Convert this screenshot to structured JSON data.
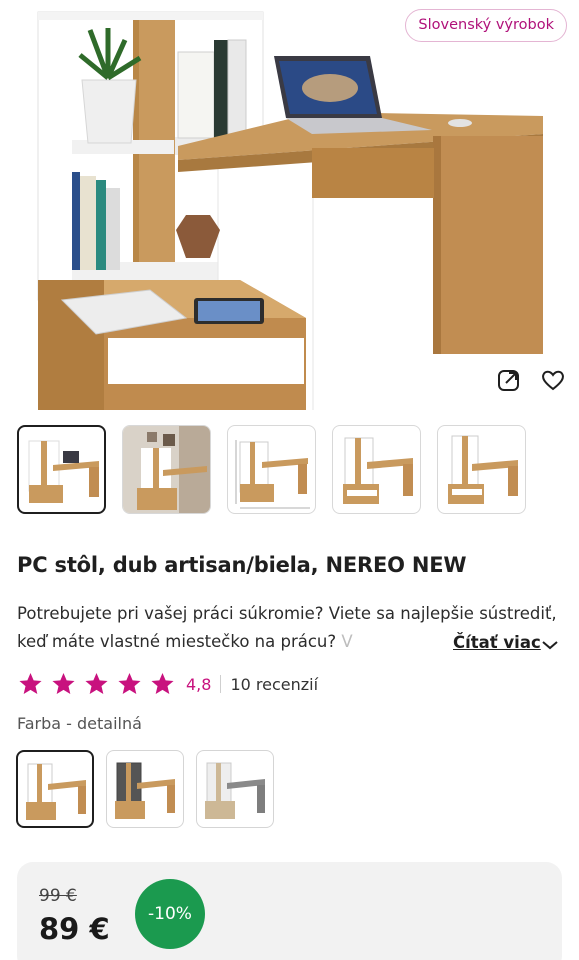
{
  "badge": {
    "label": "Slovenský výrobok"
  },
  "product": {
    "title": "PC stôl, dub artisan/biela, NEREO NEW",
    "description_main": "Potrebujete pri vašej práci súkromie? Viete sa najlepšie sústrediť, keď máte vlastné miestečko na prácu?",
    "description_fade": " V",
    "read_more": "Čítať viac"
  },
  "rating": {
    "value": "4,8",
    "stars": 5,
    "reviews": "10 recenzií"
  },
  "color": {
    "label": "Farba - detailná",
    "selected_index": 0
  },
  "price": {
    "old": "99 €",
    "current": "89 €",
    "discount": "-10%"
  },
  "thumbnails": {
    "count": 5,
    "selected_index": 0
  },
  "colors": {
    "wood": "#c99a5e",
    "wood_dark": "#a8793f",
    "white": "#ffffff",
    "accent": "#c8127e",
    "discount_green": "#1b9a4f"
  }
}
